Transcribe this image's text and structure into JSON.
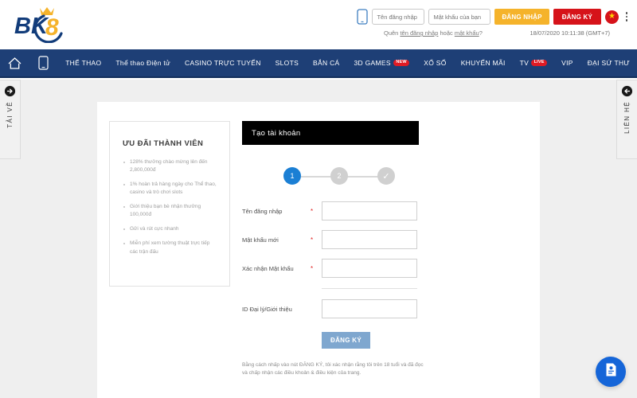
{
  "brand": {
    "name": "BK8",
    "logo_text_bk": "BK",
    "logo_text_8": "8"
  },
  "header": {
    "username_placeholder": "Tên đăng nhập",
    "password_placeholder": "Mật khẩu của bạn",
    "login_label": "ĐĂNG NHẬP",
    "register_label": "ĐĂNG KÝ",
    "forgot_prefix": "Quên ",
    "forgot_link1": "tên đăng nhập",
    "forgot_mid": " hoặc ",
    "forgot_link2": "mật khẩu",
    "forgot_suffix": "?",
    "timestamp": "18/07/2020 10:11:38 (GMT+7)",
    "language_flag": "★"
  },
  "nav": {
    "items": [
      {
        "label": "THỂ THAO",
        "badge": ""
      },
      {
        "label": "Thể thao Điện tử",
        "badge": ""
      },
      {
        "label": "CASINO TRỰC TUYẾN",
        "badge": ""
      },
      {
        "label": "SLOTS",
        "badge": ""
      },
      {
        "label": "BẮN CÁ",
        "badge": ""
      },
      {
        "label": "3D GAMES",
        "badge": "NEW"
      },
      {
        "label": "XỔ SỐ",
        "badge": ""
      },
      {
        "label": "KHUYẾN MÃI",
        "badge": ""
      },
      {
        "label": "TV",
        "badge": "LIVE"
      },
      {
        "label": "VIP",
        "badge": ""
      },
      {
        "label": "ĐẠI SỨ THƯ",
        "badge": ""
      }
    ]
  },
  "side_tabs": {
    "left_label": "TẢI VỀ",
    "right_label": "LIÊN HỆ"
  },
  "promo": {
    "title": "ƯU ĐÃI THÀNH VIÊN",
    "items": [
      "128% thưởng chào mừng lên đến 2,800,000đ",
      "1% hoàn trả hàng ngày cho Thể thao, casino và trò chơi slots",
      "Giới thiệu bạn bè nhận thưởng 100,000đ",
      "Gửi và rút cực nhanh",
      "Miễn phí xem tường thuật trực tiếp các trận đấu"
    ]
  },
  "form": {
    "title": "Tạo tài khoản",
    "steps": [
      {
        "label": "1",
        "state": "active"
      },
      {
        "label": "2",
        "state": "idle"
      },
      {
        "label": "✓",
        "state": "check"
      }
    ],
    "fields": [
      {
        "label": "Tên đăng nhập",
        "required": "*",
        "value": ""
      },
      {
        "label": "Mật khẩu mới",
        "required": "*",
        "value": ""
      },
      {
        "label": "Xác nhận Mật khẩu",
        "required": "*",
        "value": ""
      }
    ],
    "referral": {
      "label": "ID Đại lý/Giới thiệu",
      "required": "",
      "value": ""
    },
    "submit_label": "ĐĂNG KÝ",
    "terms": "Bằng cách nhấp vào nút ĐĂNG KÝ, tôi xác nhận rằng tôi trên 18 tuổi và đã đọc và chấp nhận các điều khoản & điều kiện của trang."
  },
  "colors": {
    "nav_blue": "#1e3f76",
    "accent_yellow": "#f5b32b",
    "accent_red": "#d6131a",
    "step_blue": "#1b7fd4",
    "submit_blue": "#7fa7cf",
    "chat_blue": "#1565d8"
  }
}
